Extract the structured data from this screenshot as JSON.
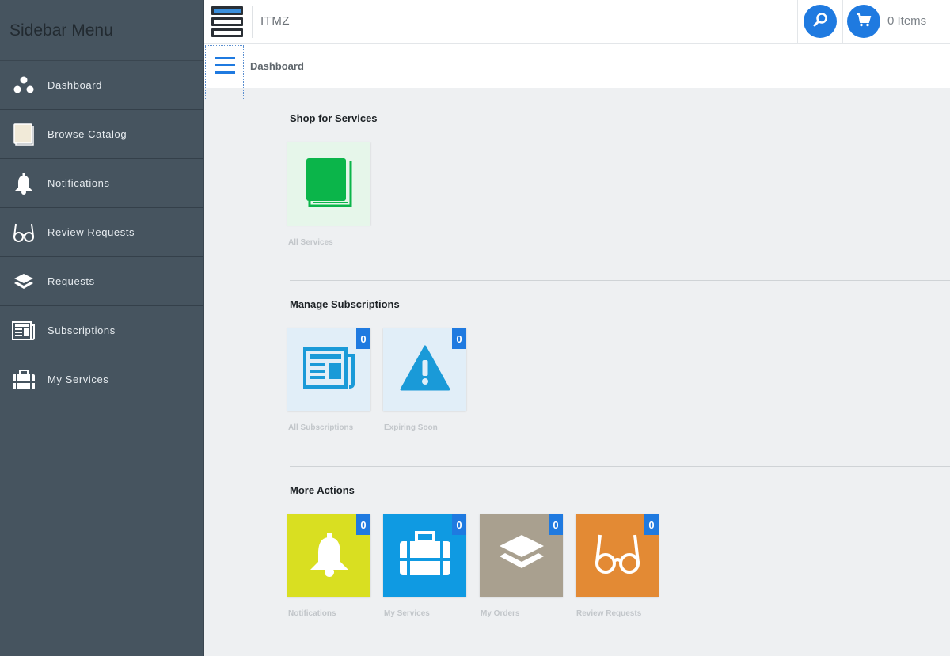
{
  "sidebar": {
    "title": "Sidebar Menu",
    "items": [
      {
        "label": "Dashboard",
        "icon": "dots-icon"
      },
      {
        "label": "Browse Catalog",
        "icon": "book-icon"
      },
      {
        "label": "Notifications",
        "icon": "bell-icon"
      },
      {
        "label": "Review Requests",
        "icon": "glasses-icon"
      },
      {
        "label": "Requests",
        "icon": "layers-icon"
      },
      {
        "label": "Subscriptions",
        "icon": "newspaper-icon"
      },
      {
        "label": "My Services",
        "icon": "briefcase-icon"
      }
    ]
  },
  "topbar": {
    "brand": "ITMZ",
    "cart_label": "0 Items"
  },
  "breadcrumb": "Dashboard",
  "sections": {
    "shop": {
      "title": "Shop for Services",
      "tiles": [
        {
          "caption": "All Services",
          "color": "#e6f6ea",
          "icon": "book-icon"
        }
      ]
    },
    "subscriptions": {
      "title": "Manage Subscriptions",
      "tiles": [
        {
          "caption": "All Subscriptions",
          "color": "#e1eef8",
          "icon": "newspaper-icon",
          "badge": "0"
        },
        {
          "caption": "Expiring Soon",
          "color": "#e1eef8",
          "icon": "warning-icon",
          "badge": "0"
        }
      ]
    },
    "actions": {
      "title": "More Actions",
      "tiles": [
        {
          "caption": "Notifications",
          "color": "#d9df21",
          "icon": "bell-icon",
          "badge": "0"
        },
        {
          "caption": "My Services",
          "color": "#0f9ae2",
          "icon": "briefcase-icon",
          "badge": "0"
        },
        {
          "caption": "My Orders",
          "color": "#a9a08f",
          "icon": "layers-icon",
          "badge": "0"
        },
        {
          "caption": "Review Requests",
          "color": "#e38a34",
          "icon": "glasses-icon",
          "badge": "0"
        }
      ]
    }
  },
  "colors": {
    "accent": "#1f7ae0",
    "sidebar_bg": "#46545f"
  }
}
